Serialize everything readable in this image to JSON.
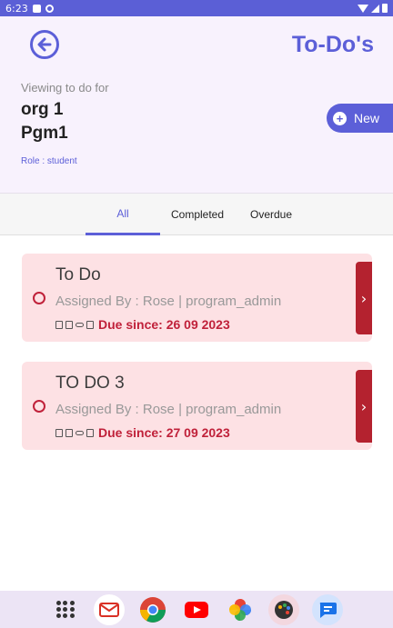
{
  "status": {
    "time": "6:23"
  },
  "header": {
    "title": "To-Do's",
    "viewing_label": "Viewing to do for",
    "org": "org 1",
    "program": "Pgm1",
    "role": "Role : student",
    "new_button": "New",
    "accent_color": "#5c5fd8"
  },
  "tabs": [
    {
      "label": "All",
      "active": true
    },
    {
      "label": "Completed",
      "active": false
    },
    {
      "label": "Overdue",
      "active": false
    }
  ],
  "todos": [
    {
      "title": "To Do",
      "assigned": "Assigned By : Rose | program_admin",
      "due": "Due since: 26 09 2023"
    },
    {
      "title": "TO DO 3",
      "assigned": "Assigned By : Rose | program_admin",
      "due": "Due since: 27 09 2023"
    }
  ],
  "dock": [
    {
      "icon": "apps-grid-icon"
    },
    {
      "icon": "gmail-icon"
    },
    {
      "icon": "chrome-icon"
    },
    {
      "icon": "youtube-icon"
    },
    {
      "icon": "photos-icon"
    },
    {
      "icon": "palette-icon"
    },
    {
      "icon": "messages-icon"
    }
  ]
}
